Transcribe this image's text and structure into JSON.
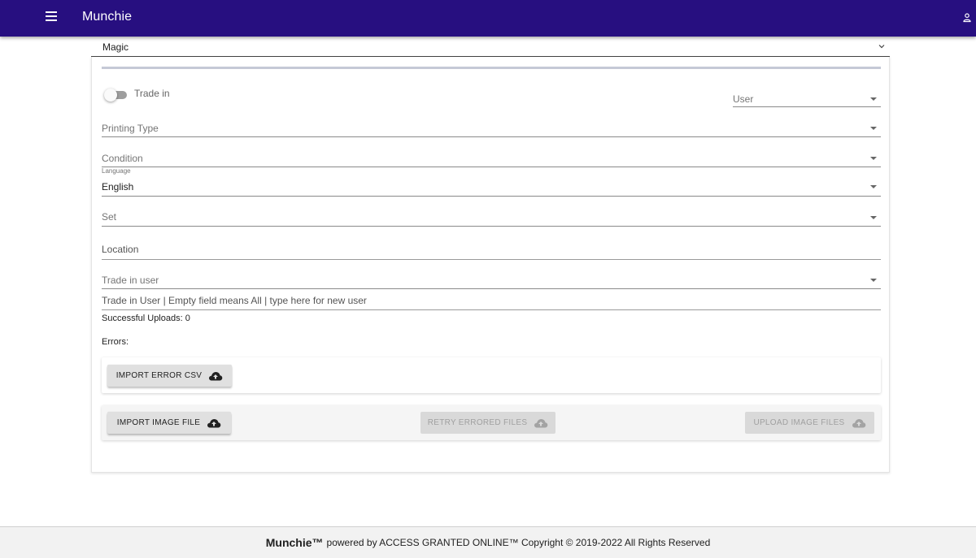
{
  "appbar": {
    "title": "Munchie",
    "menu_icon": "hamburger-menu-icon",
    "account_icon": "person-icon",
    "color": "#270f80"
  },
  "game_select": {
    "value": "Magic"
  },
  "form": {
    "trade_in_toggle_label": "Trade in",
    "trade_in_toggle_on": false,
    "user_select_placeholder": "User",
    "printing_type_placeholder": "Printing Type",
    "condition_placeholder": "Condition",
    "language_label": "Language",
    "language_value": "English",
    "set_placeholder": "Set",
    "location_placeholder": "Location",
    "trade_in_user_placeholder": "Trade in user",
    "trade_in_user_hint": "Trade in User | Empty field means All | type here for new user"
  },
  "status": {
    "successful_uploads": "Successful Uploads: 0",
    "errors_label": "Errors:"
  },
  "buttons": {
    "import_error_csv": "IMPORT ERROR CSV",
    "import_image_file": "IMPORT IMAGE FILE",
    "retry_errored_files": "RETRY ERRORED FILES",
    "upload_image_files": "UPLOAD IMAGE FILES",
    "upload_icon": "cloud-upload-icon"
  },
  "footer": {
    "brand": "Munchie™",
    "text": "powered by ACCESS GRANTED ONLINE™ Copyright © 2019-2022 All Rights Reserved"
  }
}
